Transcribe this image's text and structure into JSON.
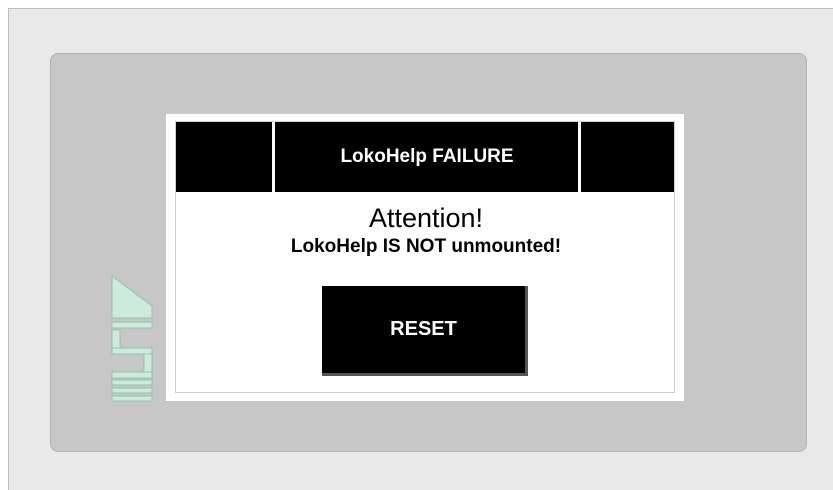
{
  "dialog": {
    "title": "LokoHelp FAILURE",
    "heading": "Attention!",
    "message": "LokoHelp IS NOT unmounted!",
    "reset_label": "RESET"
  },
  "logo": {
    "icon": "esa-brand-icon",
    "color": "#a9d6bd"
  },
  "colors": {
    "panel": "#c7c7c7",
    "frame": "#e9e9e9",
    "title_bar": "#000000",
    "button": "#000000"
  }
}
